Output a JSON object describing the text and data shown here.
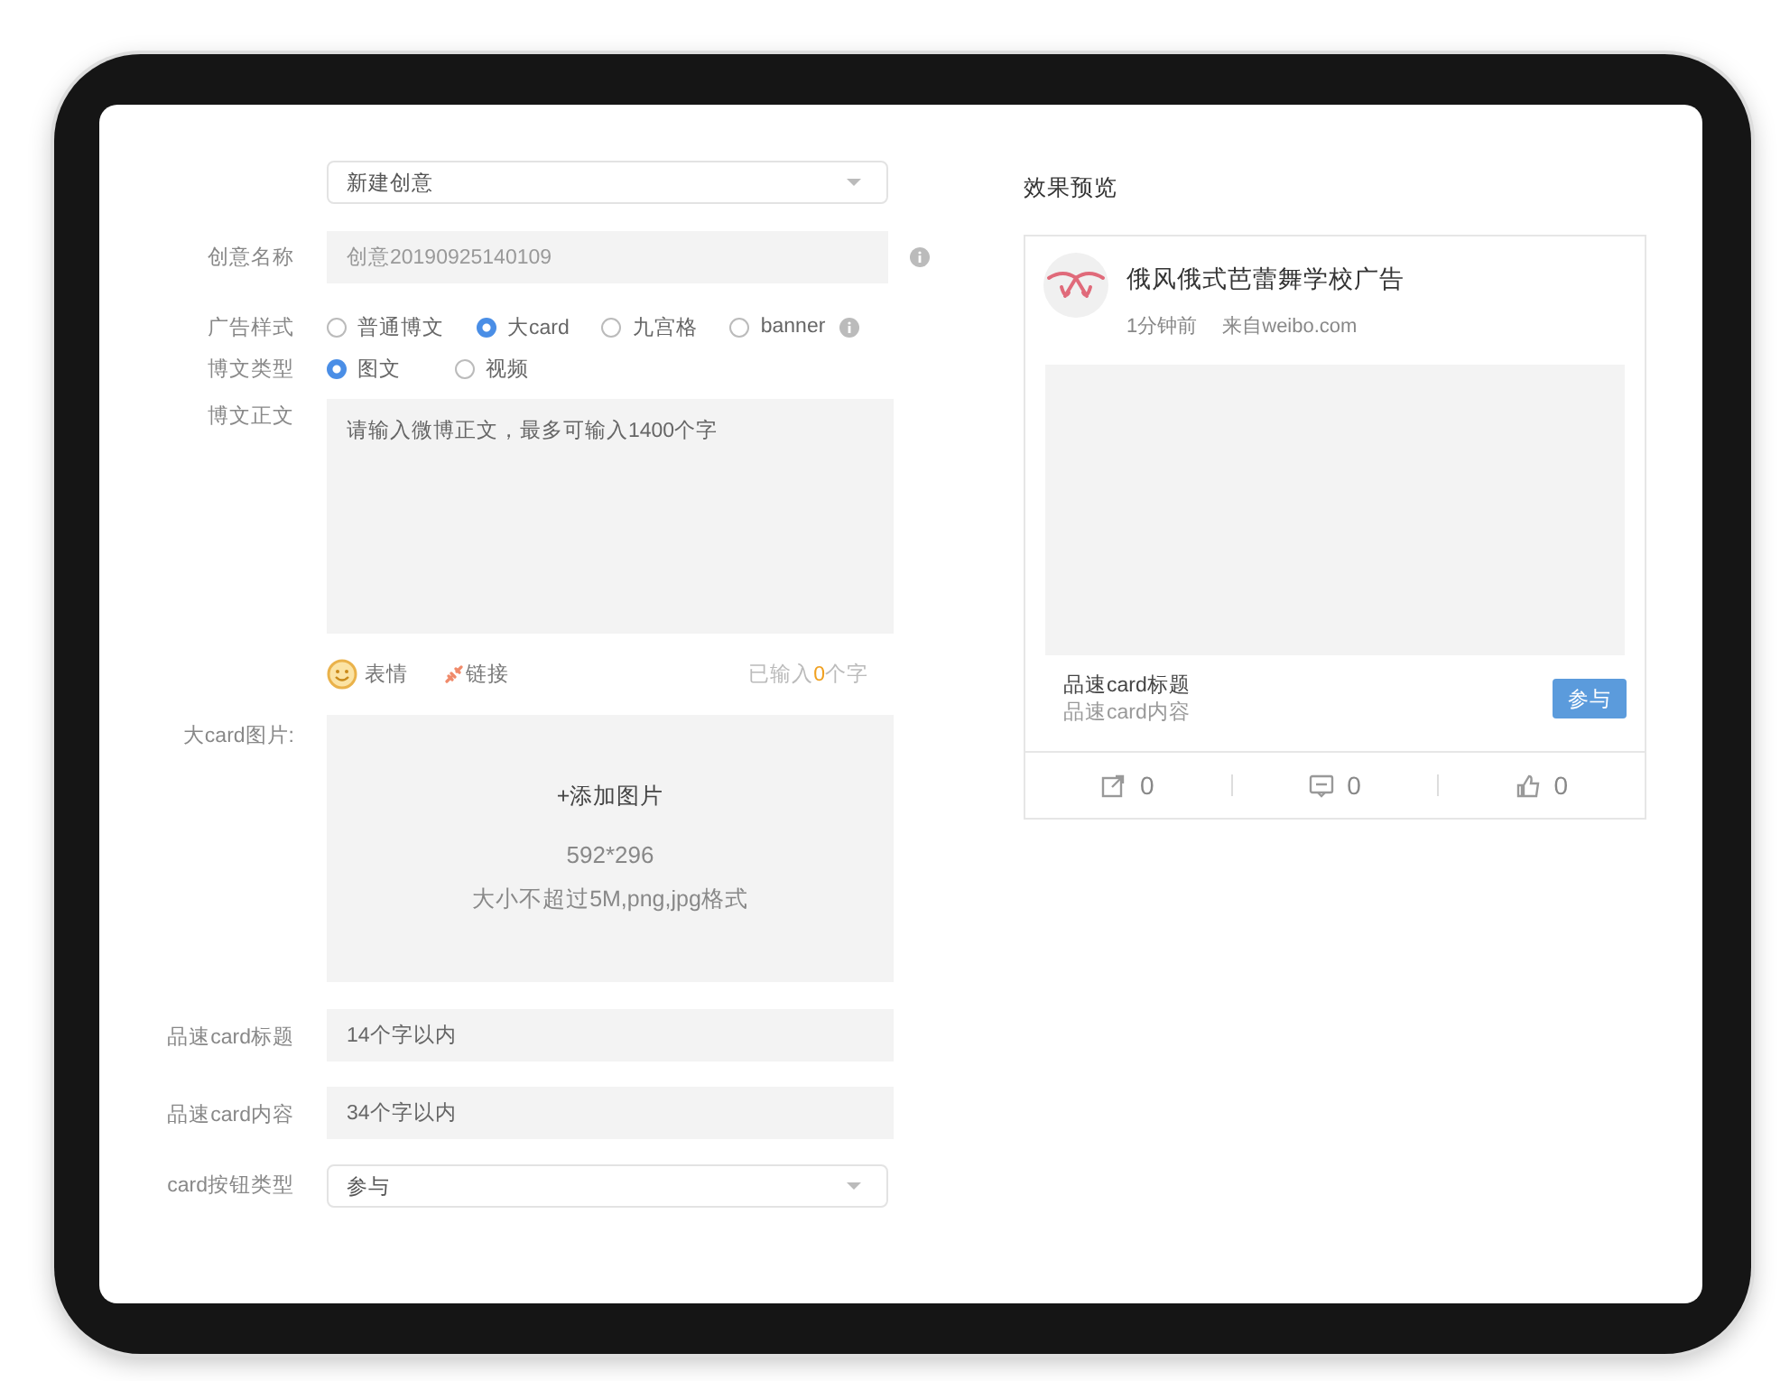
{
  "creative_select": {
    "value": "新建创意"
  },
  "form": {
    "name": {
      "label": "创意名称",
      "value": "创意20190925140109",
      "disabled": true
    },
    "ad_style": {
      "label": "广告样式",
      "options": [
        {
          "label": "普通博文",
          "selected": false
        },
        {
          "label": "大card",
          "selected": true
        },
        {
          "label": "九宫格",
          "selected": false
        },
        {
          "label": "banner",
          "selected": false
        }
      ]
    },
    "post_type": {
      "label": "博文类型",
      "options": [
        {
          "label": "图文",
          "selected": true
        },
        {
          "label": "视频",
          "selected": false
        }
      ]
    },
    "post_body": {
      "label": "博文正文",
      "placeholder": "请输入微博正文，最多可输入1400个字",
      "tools": [
        {
          "kind": "emoji",
          "label": "表情"
        },
        {
          "kind": "link",
          "label": "链接"
        }
      ],
      "counter": {
        "prefix": "已输入",
        "count": "0",
        "suffix": "个字"
      }
    },
    "card_image": {
      "label": "大card图片:",
      "action": "+添加图片",
      "size": "592*296",
      "hint": "大小不超过5M,png,jpg格式"
    },
    "card_title": {
      "label": "品速card标题",
      "placeholder": "14个字以内"
    },
    "card_content": {
      "label": "品速card内容",
      "placeholder": "34个字以内"
    },
    "button_type": {
      "label": "card按钮类型",
      "value": "参与"
    }
  },
  "preview": {
    "title": "效果预览",
    "account": "俄风俄式芭蕾舞学校广告",
    "time": "1分钟前",
    "source": "来自weibo.com",
    "card_title": "品速card标题",
    "card_content": "品速card内容",
    "button": "参与",
    "actions": [
      {
        "kind": "repost",
        "count": "0"
      },
      {
        "kind": "comment",
        "count": "0"
      },
      {
        "kind": "like",
        "count": "0"
      }
    ]
  }
}
